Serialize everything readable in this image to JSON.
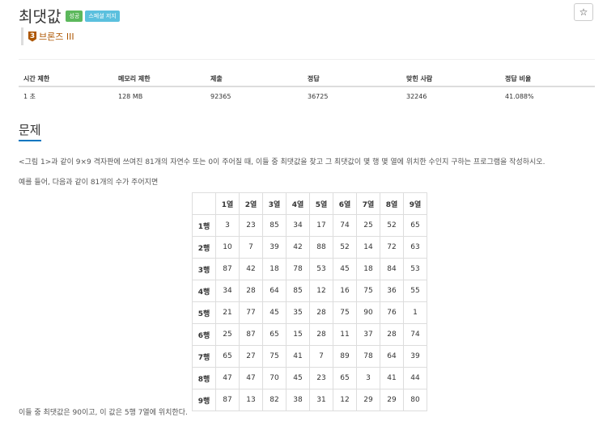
{
  "problem": {
    "title": "최댓값",
    "badges": {
      "success": "성공",
      "special": "스페셜 저지"
    },
    "star_icon": "☆",
    "tier": {
      "icon_text": "3",
      "label": "브론즈 III",
      "color": "#ad5600"
    }
  },
  "stats": {
    "headers": [
      "시간 제한",
      "메모리 제한",
      "제출",
      "정답",
      "맞힌 사람",
      "정답 비율"
    ],
    "values": [
      "1 초",
      "128 MB",
      "92365",
      "36725",
      "32246",
      "41.088%"
    ]
  },
  "section": {
    "title": "문제"
  },
  "description": {
    "line1": "<그림 1>과 같이 9×9 격자판에 쓰여진 81개의 자연수 또는 0이 주어질 때, 이들 중 최댓값을 찾고 그 최댓값이 몇 행 몇 열에 위치한 수인지 구하는 프로그램을 작성하시오.",
    "line2": "예를 들어, 다음과 같이 81개의 수가 주어지면",
    "line3": "이들 중 최댓값은 90이고, 이 값은 5행 7열에 위치한다."
  },
  "grid": {
    "col_headers": [
      "1열",
      "2열",
      "3열",
      "4열",
      "5열",
      "6열",
      "7열",
      "8열",
      "9열"
    ],
    "row_headers": [
      "1행",
      "2행",
      "3행",
      "4행",
      "5행",
      "6행",
      "7행",
      "8행",
      "9행"
    ],
    "rows": [
      [
        "3",
        "23",
        "85",
        "34",
        "17",
        "74",
        "25",
        "52",
        "65"
      ],
      [
        "10",
        "7",
        "39",
        "42",
        "88",
        "52",
        "14",
        "72",
        "63"
      ],
      [
        "87",
        "42",
        "18",
        "78",
        "53",
        "45",
        "18",
        "84",
        "53"
      ],
      [
        "34",
        "28",
        "64",
        "85",
        "12",
        "16",
        "75",
        "36",
        "55"
      ],
      [
        "21",
        "77",
        "45",
        "35",
        "28",
        "75",
        "90",
        "76",
        "1"
      ],
      [
        "25",
        "87",
        "65",
        "15",
        "28",
        "11",
        "37",
        "28",
        "74"
      ],
      [
        "65",
        "27",
        "75",
        "41",
        "7",
        "89",
        "78",
        "64",
        "39"
      ],
      [
        "47",
        "47",
        "70",
        "45",
        "23",
        "65",
        "3",
        "41",
        "44"
      ],
      [
        "87",
        "13",
        "82",
        "38",
        "31",
        "12",
        "29",
        "29",
        "80"
      ]
    ]
  }
}
